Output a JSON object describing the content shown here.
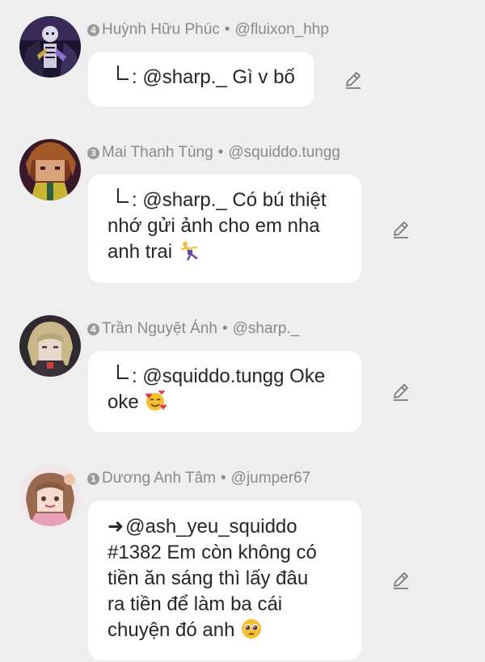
{
  "comments": [
    {
      "rank": "4",
      "name": "Huỳnh Hữu Phúc",
      "handle": "@fluixon_hhp",
      "avatar": "skeleton-avatar",
      "lines": [
        "@sharp._ Gì v bố"
      ],
      "prefix": "reply"
    },
    {
      "rank": "3",
      "name": "Mai Thanh Tùng",
      "handle": "@squiddo.tungg",
      "avatar": "brown-hair-avatar",
      "lines": [
        "@sharp._ Có bú thiệt",
        "nhớ gửi ảnh cho em nha",
        "anh trai"
      ],
      "prefix": "reply",
      "emoji": "dancing-figure-emoji"
    },
    {
      "rank": "4",
      "name": "Trần Nguyệt Ánh",
      "handle": "@sharp._",
      "avatar": "blonde-anime-avatar",
      "lines": [
        "@squiddo.tungg Oke",
        "oke"
      ],
      "prefix": "reply",
      "emoji": "smiling-face-with-hearts-emoji"
    },
    {
      "rank": "1",
      "name": "Dương Anh Tâm",
      "handle": "@jumper67",
      "avatar": "pink-anime-avatar",
      "lines": [
        "@ash_yeu_squiddo",
        "#1382 Em còn không có",
        "tiền ăn sáng thì lấy đâu",
        "ra tiền để làm ba cái",
        "chuyện đó anh"
      ],
      "prefix": "arrow",
      "emoji": "pleading-face-emoji"
    }
  ],
  "separator": "•",
  "icons": {
    "edit": "pencil-icon"
  },
  "colors": {
    "background": "#eeeeef",
    "bubble": "#ffffff",
    "meta_text": "#8a8a8e",
    "body_text": "#262626"
  }
}
